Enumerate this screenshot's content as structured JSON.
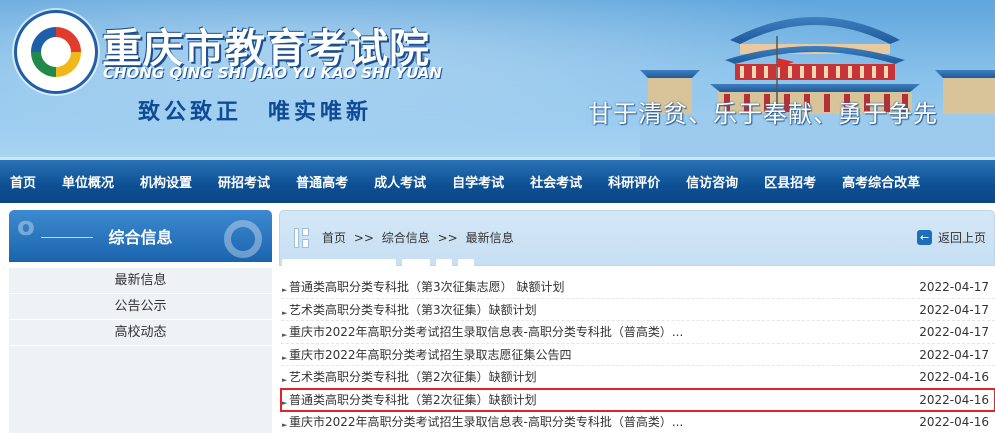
{
  "header": {
    "title_cn": "重庆市教育考试院",
    "title_en": "CHONG QING SHI JIAO YU KAO SHI YUAN",
    "motto": "致公致正　唯实唯新",
    "slogan": "甘于清贫、乐于奉献、勇于争先"
  },
  "nav": {
    "items": [
      "首页",
      "单位概况",
      "机构设置",
      "研招考试",
      "普通高考",
      "成人考试",
      "自学考试",
      "社会考试",
      "科研评价",
      "信访咨询",
      "区县招考",
      "高考综合改革"
    ]
  },
  "sidebar": {
    "title": "综合信息",
    "items": [
      "最新信息",
      "公告公示",
      "高校动态"
    ]
  },
  "breadcrumb": {
    "home": "首页",
    "sep": ">>",
    "section": "综合信息",
    "current": "最新信息",
    "back_label": "返回上页"
  },
  "list": {
    "rows": [
      {
        "title": "普通类高职分类专科批（第3次征集志愿） 缺额计划",
        "date": "2022-04-17"
      },
      {
        "title": "艺术类高职分类专科批（第3次征集）缺额计划",
        "date": "2022-04-17"
      },
      {
        "title": "重庆市2022年高职分类考试招生录取信息表-高职分类专科批（普高类）...",
        "date": "2022-04-17"
      },
      {
        "title": "重庆市2022年高职分类考试招生录取志愿征集公告四",
        "date": "2022-04-17"
      },
      {
        "title": "艺术类高职分类专科批（第2次征集）缺额计划",
        "date": "2022-04-16"
      },
      {
        "title": "普通类高职分类专科批（第2次征集）缺额计划",
        "date": "2022-04-16"
      },
      {
        "title": "重庆市2022年高职分类考试招生录取信息表-高职分类专科批（普高类）...",
        "date": "2022-04-16"
      }
    ],
    "highlight_color": "#e12525"
  },
  "colors": {
    "nav_bg": "#0d4f93",
    "banner_sky": "#86c0ea",
    "accent": "#1c6fb8"
  }
}
